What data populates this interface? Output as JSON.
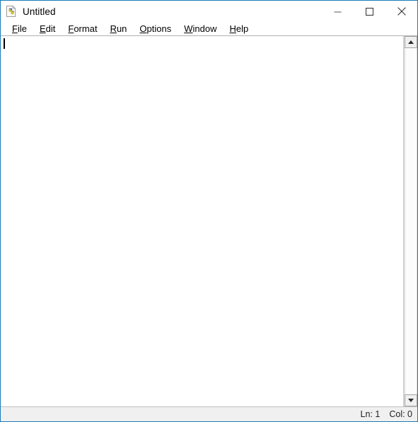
{
  "window": {
    "title": "Untitled",
    "icon": "python-idle-file-icon",
    "accent_border": "#1a7bb9",
    "controls": {
      "minimize_label": "Minimize",
      "maximize_label": "Maximize",
      "close_label": "Close"
    }
  },
  "menubar": {
    "items": [
      {
        "label": "File",
        "accesskey": "F",
        "rest": "ile"
      },
      {
        "label": "Edit",
        "accesskey": "E",
        "rest": "dit"
      },
      {
        "label": "Format",
        "accesskey": "F",
        "rest": "ormat"
      },
      {
        "label": "Run",
        "accesskey": "R",
        "rest": "un"
      },
      {
        "label": "Options",
        "accesskey": "O",
        "rest": "ptions"
      },
      {
        "label": "Window",
        "accesskey": "W",
        "rest": "indow"
      },
      {
        "label": "Help",
        "accesskey": "H",
        "rest": "elp"
      }
    ]
  },
  "editor": {
    "content": "",
    "background": "#ffffff",
    "caret_visible": true
  },
  "scrollbar": {
    "up_arrow": "scroll-up",
    "down_arrow": "scroll-down",
    "thumb_visible": false
  },
  "statusbar": {
    "line_label": "Ln: 1",
    "col_label": "Col: 0"
  }
}
